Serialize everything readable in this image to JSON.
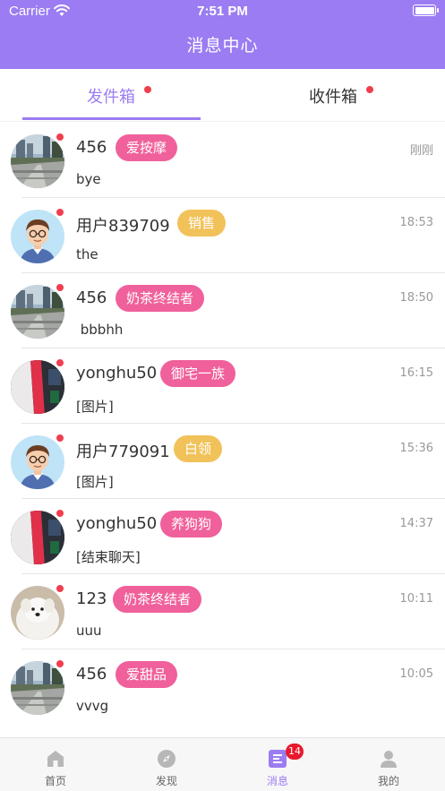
{
  "status_bar": {
    "carrier": "Carrier",
    "time": "7:51 PM"
  },
  "header": {
    "title": "消息中心"
  },
  "tabs": [
    {
      "label": "发件箱",
      "active": true,
      "has_dot": true
    },
    {
      "label": "收件箱",
      "active": false,
      "has_dot": true
    }
  ],
  "colors": {
    "accent": "#9b7cf2",
    "unread_dot": "#f03e4e",
    "tag_pink": "#f0609b",
    "tag_yellow": "#f2c25a",
    "badge_red": "#e8192c"
  },
  "messages": [
    {
      "name": "456",
      "tag": "爱按摩",
      "tag_color": "pink",
      "time": "刚刚",
      "text": "bye",
      "avatar": "city-photo"
    },
    {
      "name": "用户839709",
      "tag": "销售",
      "tag_color": "yellow",
      "time": "18:53",
      "text": "the",
      "avatar": "cartoon-man"
    },
    {
      "name": "456",
      "tag": "奶茶终结者",
      "tag_color": "pink",
      "time": "18:50",
      "text": " bbbhh",
      "avatar": "city-photo"
    },
    {
      "name": "yonghu50",
      "tag": "御宅一族",
      "tag_color": "pink",
      "time": "16:15",
      "text": "[图片]",
      "avatar": "screen-photo"
    },
    {
      "name": "用户779091",
      "tag": "白领",
      "tag_color": "yellow",
      "time": "15:36",
      "text": "[图片]",
      "avatar": "cartoon-man"
    },
    {
      "name": "yonghu50",
      "tag": "养狗狗",
      "tag_color": "pink",
      "time": "14:37",
      "text": "[结束聊天]",
      "avatar": "screen-photo"
    },
    {
      "name": "123",
      "tag": "奶茶终结者",
      "tag_color": "pink",
      "time": "10:11",
      "text": "uuu",
      "avatar": "dog-photo"
    },
    {
      "name": "456",
      "tag": "爱甜品",
      "tag_color": "pink",
      "time": "10:05",
      "text": "vvvg",
      "avatar": "city-photo"
    }
  ],
  "tabbar": [
    {
      "label": "首页",
      "icon": "home-icon",
      "active": false
    },
    {
      "label": "发现",
      "icon": "compass-icon",
      "active": false
    },
    {
      "label": "消息",
      "icon": "message-icon",
      "active": true,
      "badge": "14"
    },
    {
      "label": "我的",
      "icon": "profile-icon",
      "active": false
    }
  ]
}
